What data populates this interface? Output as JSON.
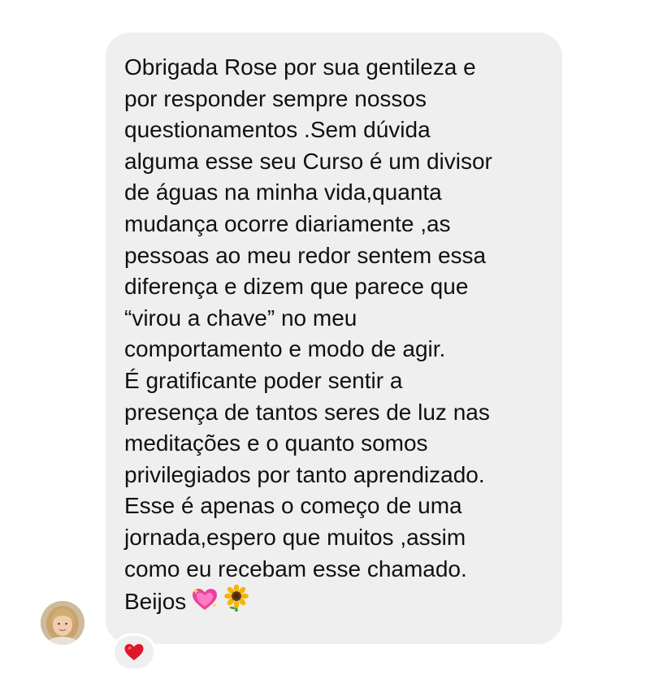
{
  "message": {
    "lines": [
      "Obrigada Rose por sua gentileza e",
      "por responder sempre nossos",
      "questionamentos .Sem dúvida",
      "alguma esse seu Curso é um divisor",
      "de águas na minha vida,quanta",
      "mudança ocorre diariamente ,as",
      "pessoas ao meu redor sentem essa",
      "diferença e dizem que parece que",
      "“virou a chave” no meu",
      "comportamento e modo de agir.",
      "É gratificante poder sentir a",
      "presença de tantos seres de luz nas",
      "meditações e o quanto somos",
      "privilegiados por tanto aprendizado.",
      "Esse é apenas o começo de uma",
      "jornada,espero que muitos ,assim",
      "como eu recebam esse chamado.",
      "Beijos"
    ],
    "emojis": [
      "sparkling-heart",
      "sunflower"
    ]
  },
  "reaction": {
    "icon": "red-heart",
    "color": "#e0162b"
  },
  "colors": {
    "bubble": "#efefef",
    "text": "#111111",
    "background": "#ffffff"
  }
}
